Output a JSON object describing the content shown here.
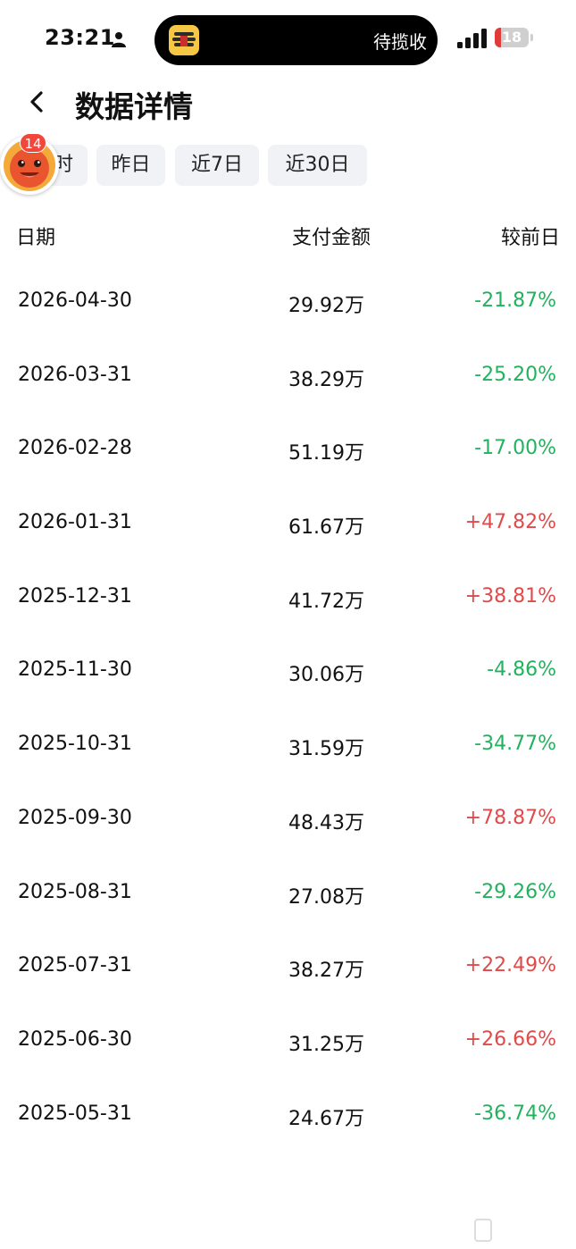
{
  "status_bar": {
    "time": "23:21",
    "island_text": "待揽收",
    "battery_level": "18",
    "battery_fraction": 0.18,
    "icons": [
      "person-icon",
      "signal-icon",
      "battery-icon"
    ]
  },
  "header": {
    "title": "数据详情",
    "back_icon": "chevron-left-icon"
  },
  "filters": [
    {
      "label": "时"
    },
    {
      "label": "昨日"
    },
    {
      "label": "近7日"
    },
    {
      "label": "近30日"
    }
  ],
  "floating_widget": {
    "badge_count": "14",
    "icon": "mascot-avatar-icon"
  },
  "table": {
    "headers": {
      "date": "日期",
      "amount": "支付金额",
      "change": "较前日"
    },
    "rows": [
      {
        "date": "2026-04-30",
        "amount": "29.92万",
        "change": "-21.87%",
        "direction": "down"
      },
      {
        "date": "2026-03-31",
        "amount": "38.29万",
        "change": "-25.20%",
        "direction": "down"
      },
      {
        "date": "2026-02-28",
        "amount": "51.19万",
        "change": "-17.00%",
        "direction": "down"
      },
      {
        "date": "2026-01-31",
        "amount": "61.67万",
        "change": "+47.82%",
        "direction": "up"
      },
      {
        "date": "2025-12-31",
        "amount": "41.72万",
        "change": "+38.81%",
        "direction": "up"
      },
      {
        "date": "2025-11-30",
        "amount": "30.06万",
        "change": "-4.86%",
        "direction": "down"
      },
      {
        "date": "2025-10-31",
        "amount": "31.59万",
        "change": "-34.77%",
        "direction": "down"
      },
      {
        "date": "2025-09-30",
        "amount": "48.43万",
        "change": "+78.87%",
        "direction": "up"
      },
      {
        "date": "2025-08-31",
        "amount": "27.08万",
        "change": "-29.26%",
        "direction": "down"
      },
      {
        "date": "2025-07-31",
        "amount": "38.27万",
        "change": "+22.49%",
        "direction": "up"
      },
      {
        "date": "2025-06-30",
        "amount": "31.25万",
        "change": "+26.66%",
        "direction": "up"
      },
      {
        "date": "2025-05-31",
        "amount": "24.67万",
        "change": "-36.74%",
        "direction": "down"
      }
    ]
  },
  "colors": {
    "up": "#e04a4a",
    "down": "#22b25e",
    "chip_bg": "#f1f2f6",
    "badge": "#f0473d"
  }
}
